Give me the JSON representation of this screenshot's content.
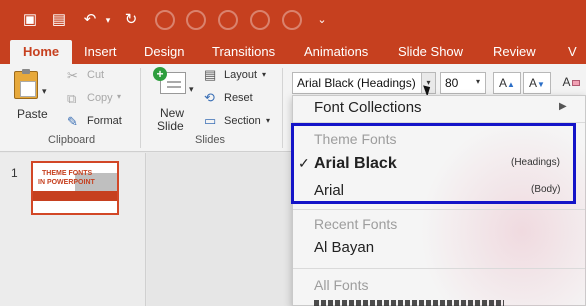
{
  "ribbon_tabs": [
    "Home",
    "Insert",
    "Design",
    "Transitions",
    "Animations",
    "Slide Show",
    "Review",
    "V"
  ],
  "clipboard": {
    "paste": "Paste",
    "cut": "Cut",
    "copy": "Copy",
    "format": "Format",
    "group": "Clipboard"
  },
  "slides_group": {
    "new_slide_1": "New",
    "new_slide_2": "Slide",
    "layout": "Layout",
    "reset": "Reset",
    "section": "Section",
    "group": "Slides"
  },
  "font": {
    "name": "Arial Black (Headings)",
    "size": "80"
  },
  "slide_panel": {
    "number": "1",
    "thumb_line1": "THEME FONTS",
    "thumb_line2": "IN POWERPOINT"
  },
  "menu": {
    "collections": "Font Collections",
    "theme_header": "Theme Fonts",
    "heading_font": "Arial Black",
    "heading_tag": "(Headings)",
    "body_font": "Arial",
    "body_tag": "(Body)",
    "recent_header": "Recent Fonts",
    "recent_font": "Al Bayan",
    "all_header": "All Fonts"
  },
  "colors": {
    "accent": "#c6401f",
    "highlight_box": "#1414c8"
  }
}
